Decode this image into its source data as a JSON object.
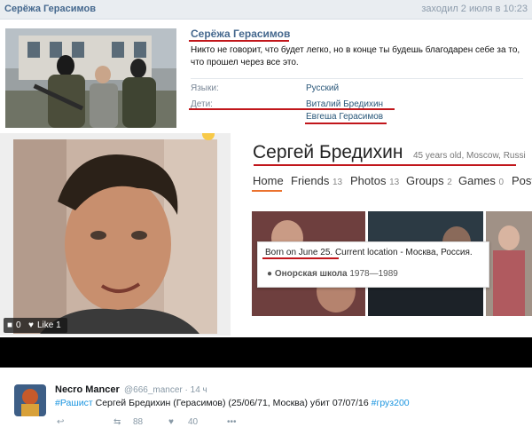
{
  "vk": {
    "header_name": "Серёжа Герасимов",
    "last_seen": "заходил 2 июля в 10:23",
    "profile_name": "Серёжа Герасимов",
    "status": "Никто не говорит, что будет легко, но в конце ты будешь благодарен себе за то, что прошел через все это.",
    "rows": {
      "languages_label": "Языки:",
      "languages_value": "Русский",
      "children_label": "Дети:",
      "child1": "Виталий Бредихин",
      "child2": "Евгеша Герасимов"
    }
  },
  "ok": {
    "name": "Сергей Бредихин",
    "meta": "45 years old, Moscow, Russi",
    "tabs": [
      {
        "label": "Home",
        "count": ""
      },
      {
        "label": "Friends",
        "count": "13"
      },
      {
        "label": "Photos",
        "count": "13"
      },
      {
        "label": "Groups",
        "count": "2"
      },
      {
        "label": "Games",
        "count": "0"
      },
      {
        "label": "Post",
        "count": ""
      }
    ],
    "photo_bar": {
      "comments": "0",
      "likes": "Like 1"
    },
    "card": {
      "born": "Born on June 25. Current location - Москва, Россия.",
      "school_name": "Онорская школа",
      "school_years": "1978—1989"
    }
  },
  "tweet": {
    "name": "Necro Mancer",
    "handle": "@666_mancer · 14 ч",
    "hashtag1": "#Рашист",
    "text_mid": " Сергей Бредихин (Герасимов) (25/06/71, Москва) убит 07/07/16 ",
    "hashtag2": "#груз200",
    "retweets": "88",
    "likes": "40"
  },
  "colors": {
    "vk_link": "#45688e",
    "underline_red": "#c1161b",
    "ok_orange": "#eb722e",
    "twitter_blue": "#1b95e0"
  }
}
